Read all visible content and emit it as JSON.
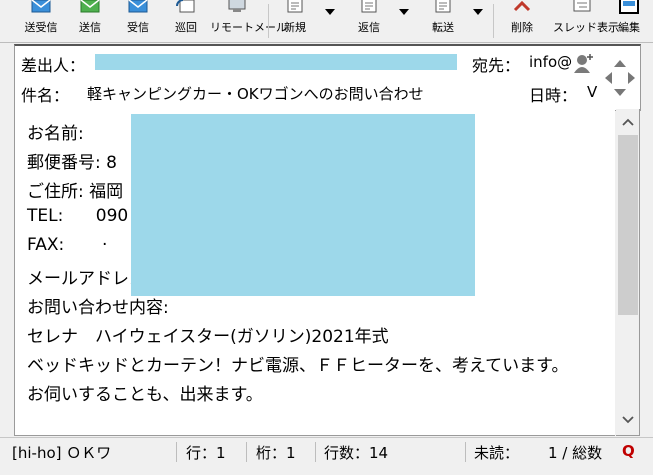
{
  "toolbar": {
    "buttons": [
      {
        "label": "送受信",
        "icon": "send-receive-icon"
      },
      {
        "label": "送信",
        "icon": "send-icon"
      },
      {
        "label": "受信",
        "icon": "receive-icon"
      },
      {
        "label": "巡回",
        "icon": "patrol-icon"
      },
      {
        "label": "リモートメール",
        "icon": "remote-mail-icon"
      },
      {
        "label": "新規",
        "icon": "new-mail-icon"
      },
      {
        "label": "返信",
        "icon": "reply-icon"
      },
      {
        "label": "転送",
        "icon": "forward-icon"
      },
      {
        "label": "削除",
        "icon": "delete-icon"
      },
      {
        "label": "スレッド表示",
        "icon": "thread-view-icon"
      },
      {
        "label": "編集",
        "icon": "edit-icon"
      }
    ]
  },
  "header": {
    "from_label": "差出人：",
    "to_label": "宛先：",
    "to_value": "info@",
    "subject_label": "件名：",
    "subject_value": "軽キャンピングカー・OKワゴンへのお問い合わせ",
    "date_label": "日時：",
    "date_value": "V"
  },
  "body": {
    "lines": [
      "お名前:",
      "郵便番号: 8",
      "ご住所: 福岡",
      "TEL:      090",
      "FAX:       ·",
      "メールアドレス",
      "お問い合わせ内容:",
      "セレナ　ハイウェイスター(ガソリン)2021年式",
      "ベッドキッドとカーテン！ナビ電源、ＦＦヒーターを、考えています。",
      "お伺いすることも、出来ます。"
    ]
  },
  "status": {
    "account": "[hi-ho] ＯＫワ",
    "row": "行：1",
    "col": "桁：1",
    "lines": "行数：14",
    "unread": "未読：",
    "count": "1 / 総数"
  },
  "colors": {
    "redaction": "#9dd8ea",
    "status_q": "#c00000"
  }
}
